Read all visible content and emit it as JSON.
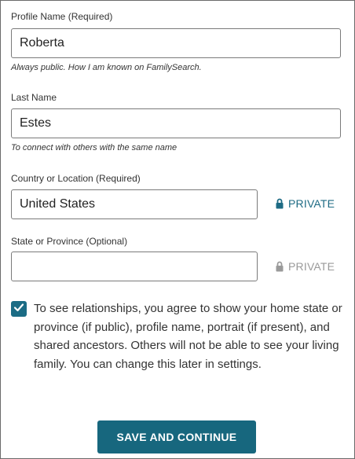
{
  "form": {
    "profile_name": {
      "label": "Profile Name (Required)",
      "value": "Roberta",
      "hint": "Always public. How I am known on FamilySearch."
    },
    "last_name": {
      "label": "Last Name",
      "value": "Estes",
      "hint": "To connect with others with the same name"
    },
    "country": {
      "label": "Country or Location (Required)",
      "value": "United States",
      "privacy_label": "PRIVATE"
    },
    "state": {
      "label": "State or Province (Optional)",
      "value": "",
      "privacy_label": "PRIVATE"
    },
    "consent": {
      "checked": true,
      "text": "To see relationships, you agree to show your home state or province (if public), profile name, portrait (if present), and shared ancestors. Others will not be able to see your living family. You can change this later in settings."
    },
    "save_label": "SAVE AND CONTINUE"
  },
  "colors": {
    "accent": "#1b6c85",
    "button": "#17677e",
    "muted": "#9a9a9a"
  },
  "icons": {
    "privacy": "lock-icon",
    "checkbox": "checkmark-icon"
  }
}
